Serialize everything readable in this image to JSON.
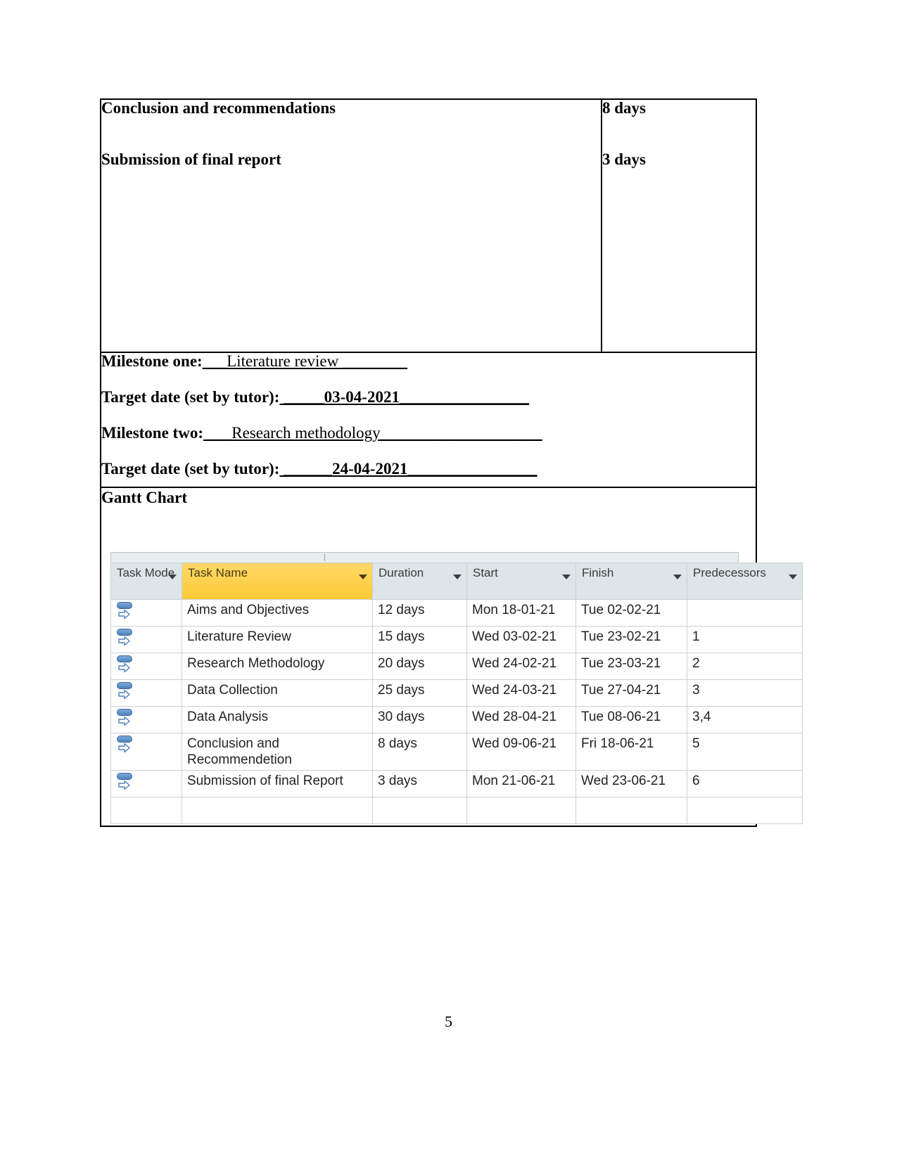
{
  "document": {
    "page_number": "5"
  },
  "task_summary": {
    "tasks": [
      {
        "name": "Conclusion and recommendations",
        "duration": "8 days"
      },
      {
        "name": "Submission of final report",
        "duration": "3 days"
      }
    ]
  },
  "milestones": [
    {
      "label": "Milestone one:",
      "lead_rule": "___",
      "value": "Literature review",
      "trail_rule": " ________"
    },
    {
      "label": "Target date (set by tutor):",
      "lead_rule": " _____",
      "value": "03-04-2021",
      "trail_rule": "________________"
    },
    {
      "label": "Milestone two:",
      "lead_rule": " ___",
      "value": "Research methodology",
      "trail_rule": "____________________"
    },
    {
      "label": "Target date (set by tutor):",
      "lead_rule": " ______",
      "value": "24-04-2021",
      "trail_rule": "________________"
    }
  ],
  "gantt": {
    "title": "Gantt Chart",
    "columns": [
      {
        "id": "mode",
        "label": "Task Mode",
        "selected": false
      },
      {
        "id": "name",
        "label": "Task Name",
        "selected": true
      },
      {
        "id": "dur",
        "label": "Duration",
        "selected": false
      },
      {
        "id": "start",
        "label": "Start",
        "selected": false
      },
      {
        "id": "fin",
        "label": "Finish",
        "selected": false
      },
      {
        "id": "pred",
        "label": "Predecessors",
        "selected": false
      }
    ],
    "header_colors": {
      "default_bg": "#dde5e8",
      "selected_bg": "#ffc936",
      "grid_line": "#c9d1d6"
    },
    "mode_icon": "manually-scheduled-icon",
    "rows": [
      {
        "mode": "manually-scheduled-icon",
        "name": "Aims and Objectives",
        "duration": "12 days",
        "start": "Mon 18-01-21",
        "finish": "Tue 02-02-21",
        "predecessors": ""
      },
      {
        "mode": "manually-scheduled-icon",
        "name": "Literature Review",
        "duration": "15 days",
        "start": "Wed 03-02-21",
        "finish": "Tue 23-02-21",
        "predecessors": "1"
      },
      {
        "mode": "manually-scheduled-icon",
        "name": "Research Methodology",
        "duration": "20 days",
        "start": "Wed 24-02-21",
        "finish": "Tue 23-03-21",
        "predecessors": "2"
      },
      {
        "mode": "manually-scheduled-icon",
        "name": "Data Collection",
        "duration": "25 days",
        "start": "Wed 24-03-21",
        "finish": "Tue 27-04-21",
        "predecessors": "3"
      },
      {
        "mode": "manually-scheduled-icon",
        "name": "Data Analysis",
        "duration": "30 days",
        "start": "Wed 28-04-21",
        "finish": "Tue 08-06-21",
        "predecessors": "3,4"
      },
      {
        "mode": "manually-scheduled-icon",
        "name": "Conclusion and Recommendetion",
        "duration": "8 days",
        "start": "Wed 09-06-21",
        "finish": "Fri 18-06-21",
        "predecessors": "5"
      },
      {
        "mode": "manually-scheduled-icon",
        "name": "Submission of final Report",
        "duration": "3 days",
        "start": "Mon 21-06-21",
        "finish": "Wed 23-06-21",
        "predecessors": "6"
      }
    ]
  }
}
